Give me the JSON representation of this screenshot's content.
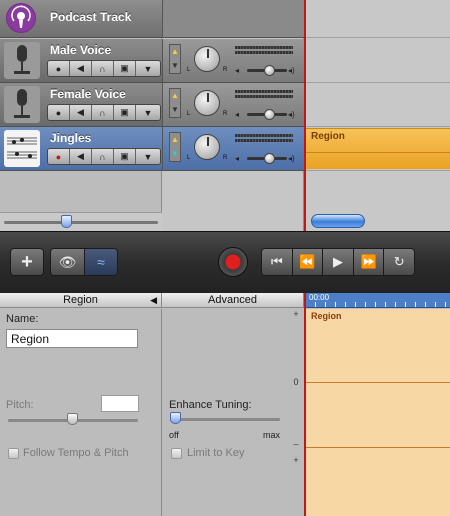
{
  "tracks": [
    {
      "name": "Podcast Track"
    },
    {
      "name": "Male Voice"
    },
    {
      "name": "Female Voice"
    },
    {
      "name": "Jingles"
    }
  ],
  "timeline": {
    "region_label": "Region"
  },
  "editor": {
    "region_header": "Region",
    "advanced_header": "Advanced",
    "ruler_time": "00:00",
    "name_label": "Name:",
    "name_value": "Region",
    "pitch_label": "Pitch:",
    "follow_tempo_label": "Follow Tempo & Pitch",
    "enhance_tuning_label": "Enhance Tuning:",
    "enhance_tuning_min": "off",
    "enhance_tuning_max": "max",
    "limit_to_key_label": "Limit to Key",
    "scale_plus_top": "+",
    "scale_zero": "0",
    "scale_minus": "–",
    "scale_plus_bottom": "+",
    "lane_region_label": "Region"
  },
  "transport": {
    "add_symbol": "+",
    "eye_symbol": "👁",
    "wave_symbol": "≈",
    "rewind_start_symbol": "⏮",
    "rewind_symbol": "⏪",
    "play_symbol": "▶",
    "forward_symbol": "⏩",
    "loop_symbol": "↻"
  },
  "colors": {
    "selected_track": "#5a7cb4",
    "region": "#f0b43c",
    "playhead": "#c01818",
    "editor_lane": "#f7d7a4"
  }
}
